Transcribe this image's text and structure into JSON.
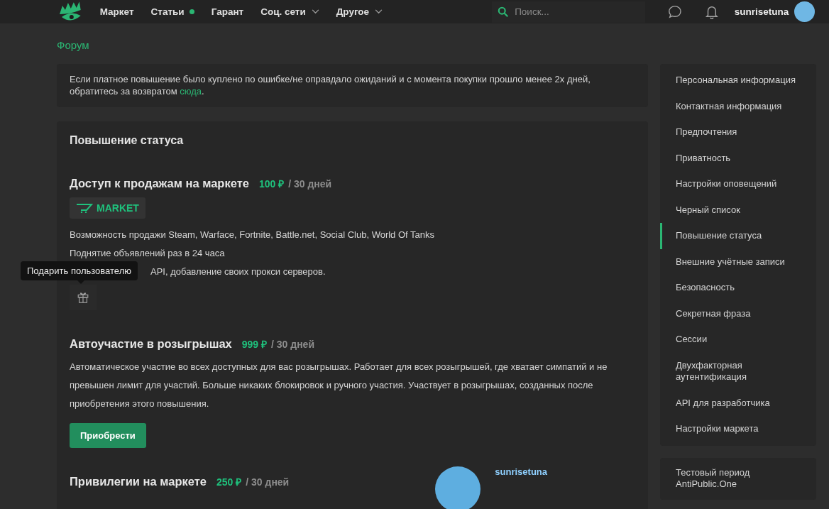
{
  "header": {
    "nav": [
      {
        "label": "Маркет",
        "dot": false,
        "dropdown": false
      },
      {
        "label": "Статьи",
        "dot": true,
        "dropdown": false
      },
      {
        "label": "Гарант",
        "dot": false,
        "dropdown": false
      },
      {
        "label": "Соц. сети",
        "dot": false,
        "dropdown": true
      },
      {
        "label": "Другое",
        "dot": false,
        "dropdown": true
      }
    ],
    "search": {
      "placeholder": "Поиск..."
    },
    "username": "sunrisetuna"
  },
  "breadcrumb": "Форум",
  "notice": {
    "text": "Если платное повышение было куплено по ошибке/не оправдало ожиданий и с момента покупки прошло менее 2х дней, обратитесь за возвратом ",
    "link": "сюда",
    "end": "."
  },
  "section_title": "Повышение статуса",
  "upgrades": [
    {
      "title": "Доступ к продажам на маркете",
      "price": "100 ₽",
      "period": "/ 30 дней",
      "badge": "MARKET",
      "features": [
        "Возможность продажи Steam, Warface, Fortnite, Battle.net, Social Club, World Of Tanks",
        "Поднятие объявлений раз в 24 часа"
      ],
      "covered_feature": "API, добавление своих прокси серверов.",
      "gift_tooltip": "Подарить пользователю"
    },
    {
      "title": "Автоучастие в розыгрышах",
      "price": "999 ₽",
      "period": "/ 30 дней",
      "description": "Автоматическое участие во всех доступных для вас розыгрышах. Работает для всех розыгрышей, где хватает симпатий и не превышен лимит для участий. Больше никаких блокировок и ручного участия. Участвует в розыгрышах, созданных после приобретения этого повышения.",
      "button": "Приобрести"
    },
    {
      "title": "Привилегии на маркете",
      "price": "250 ₽",
      "period": "/ 30 дней",
      "preview_user": "sunrisetuna"
    }
  ],
  "sidebar": {
    "items": [
      {
        "label": "Персональная информация",
        "selected": false
      },
      {
        "label": "Контактная информация",
        "selected": false
      },
      {
        "label": "Предпочтения",
        "selected": false
      },
      {
        "label": "Приватность",
        "selected": false
      },
      {
        "label": "Настройки оповещений",
        "selected": false
      },
      {
        "label": "Черный список",
        "selected": false
      },
      {
        "label": "Повышение статуса",
        "selected": true
      },
      {
        "label": "Внешние учётные записи",
        "selected": false
      },
      {
        "label": "Безопасность",
        "selected": false
      },
      {
        "label": "Секретная фраза",
        "selected": false
      },
      {
        "label": "Сессии",
        "selected": false
      },
      {
        "label": "Двухфакторная аутентификация",
        "selected": false
      },
      {
        "label": "API для разработчика",
        "selected": false
      },
      {
        "label": "Настройки маркета",
        "selected": false
      }
    ],
    "extra": [
      "Тестовый период",
      "AntiPublic.One"
    ]
  }
}
